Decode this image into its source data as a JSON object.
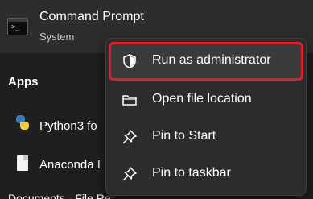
{
  "top_result": {
    "title": "Command Prompt",
    "subtitle": "System",
    "icon": "cmd-icon",
    "icon_text": ">_"
  },
  "apps_section": {
    "heading": "Apps",
    "items": [
      {
        "label": "Python3 fo",
        "icon": "python-icon"
      },
      {
        "label": "Anaconda I",
        "icon": "document-icon"
      }
    ],
    "partial_below": "Documents - File Re"
  },
  "context_menu": {
    "items": [
      {
        "label": "Run as administrator",
        "icon": "shield-icon",
        "highlighted": true
      },
      {
        "label": "Open file location",
        "icon": "folder-icon"
      },
      {
        "label": "Pin to Start",
        "icon": "pin-icon"
      },
      {
        "label": "Pin to taskbar",
        "icon": "pin-icon"
      }
    ]
  },
  "colors": {
    "highlight_border": "#e01f2d",
    "menu_bg": "#2c2c2c",
    "page_bg": "#1f1f1f"
  }
}
